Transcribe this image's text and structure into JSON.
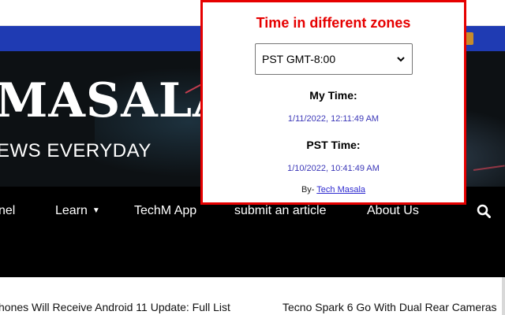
{
  "site": {
    "logo_text": "MASALA",
    "tagline": "EWS EVERYDAY",
    "nav": {
      "items": [
        "nel",
        "Learn",
        "TechM App",
        "submit an article",
        "About Us"
      ],
      "search_icon": "search-icon"
    },
    "ticker": [
      "hones Will Receive Android 11 Update: Full List",
      "Tecno Spark 6 Go With Dual Rear Cameras"
    ],
    "colors": {
      "top_bar": "#1f3bb3",
      "hero_bg": "#0d1114",
      "nav_bg": "#000000"
    }
  },
  "popup": {
    "title": "Time in different zones",
    "select": {
      "value": "PST GMT-8:00",
      "icon": "chevron-down-icon"
    },
    "my_time_label": "My Time:",
    "my_time_value": "1/11/2022, 12:11:49 AM",
    "zone_time_label": "PST Time:",
    "zone_time_value": "1/10/2022, 10:41:49 AM",
    "byline_prefix": "By-",
    "byline_link": "Tech Masala",
    "colors": {
      "border": "#e60000",
      "title": "#e60000",
      "time_value": "#3c38b8"
    }
  }
}
